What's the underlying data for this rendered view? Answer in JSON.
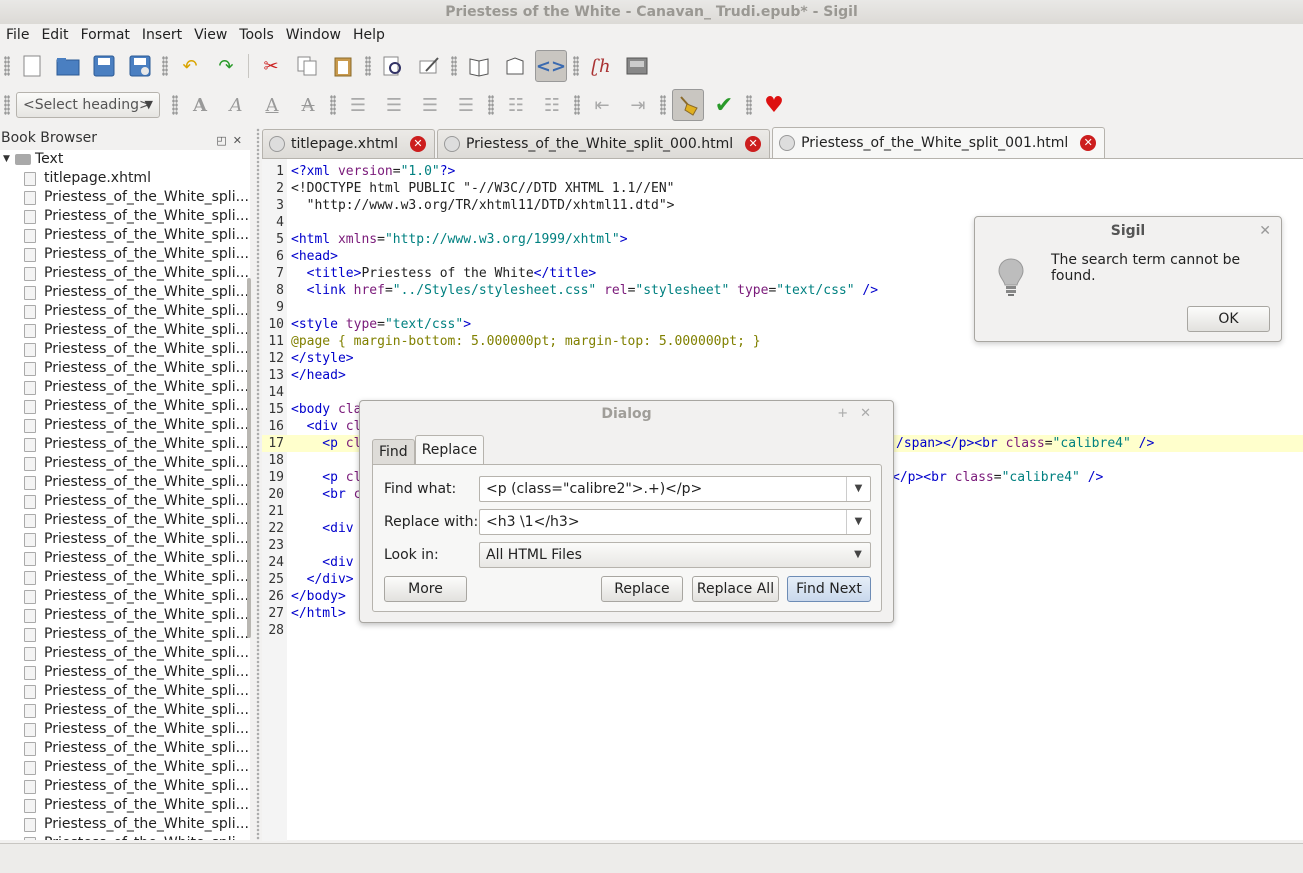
{
  "window": {
    "title": "Priestess of the White - Canavan_ Trudi.epub* - Sigil"
  },
  "menubar": {
    "items": [
      "File",
      "Edit",
      "Format",
      "Insert",
      "View",
      "Tools",
      "Window",
      "Help"
    ]
  },
  "toolbar2": {
    "heading_select": "<Select heading>"
  },
  "book_browser": {
    "title": "Book Browser",
    "folder": "Text",
    "first_file": "titlepage.xhtml",
    "file_label": "Priestess_of_the_White_spli..."
  },
  "tabs": [
    {
      "label": "titlepage.xhtml"
    },
    {
      "label": "Priestess_of_the_White_split_000.html"
    },
    {
      "label": "Priestess_of_the_White_split_001.html"
    }
  ],
  "editor": {
    "lines": [
      "1",
      "2",
      "3",
      "4",
      "5",
      "6",
      "7",
      "8",
      "9",
      "10",
      "11",
      "12",
      "13",
      "14",
      "15",
      "16",
      "17",
      "18",
      "19",
      "20",
      "21",
      "22",
      "23",
      "24",
      "25",
      "26",
      "27",
      "28"
    ],
    "code": {
      "l1a": "<?xml ",
      "l1b": "version",
      "l1c": "=",
      "l1d": "\"1.0\"",
      "l1e": "?>",
      "l2": "<!DOCTYPE html PUBLIC \"-//W3C//DTD XHTML 1.1//EN\"",
      "l3": "  \"http://www.w3.org/TR/xhtml11/DTD/xhtml11.dtd\">",
      "l5a": "<html ",
      "l5b": "xmlns",
      "l5c": "=",
      "l5d": "\"http://www.w3.org/1999/xhtml\"",
      "l5e": ">",
      "l6": "<head>",
      "l7a": "  <title>",
      "l7b": "Priestess of the White",
      "l7c": "</title>",
      "l8a": "  <link ",
      "l8b": "href",
      "l8c": "=",
      "l8d": "\"../Styles/stylesheet.css\"",
      "l8e": " rel",
      "l8f": "=",
      "l8g": "\"stylesheet\"",
      "l8h": " type",
      "l8i": "=",
      "l8j": "\"text/css\"",
      "l8k": " />",
      "l10a": "<style ",
      "l10b": "type",
      "l10c": "=",
      "l10d": "\"text/css\"",
      "l10e": ">",
      "l11": "@page { margin-bottom: 5.000000pt; margin-top: 5.000000pt; }",
      "l12": "</style>",
      "l13": "</head>",
      "l15a": "<body ",
      "l15b": "cla",
      "l16a": "  <div ",
      "l16b": "cl",
      "l17a": "    <p ",
      "l17b": "cl",
      "l17c": "/span></p><br ",
      "l17d": "class",
      "l17e": "=",
      "l17f": "\"calibre4\"",
      "l17g": " />",
      "l19a": "    <p ",
      "l19b": "cl",
      "l19c": "</p><br ",
      "l19d": "class",
      "l19e": "=",
      "l19f": "\"calibre4\"",
      "l19g": " />",
      "l20a": "    <br ",
      "l20b": "c",
      "l22": "    <div",
      "l24": "    <div",
      "l25": "  </div>",
      "l26": "</body>",
      "l27": "</html>"
    }
  },
  "find_dialog": {
    "title": "Dialog",
    "tab_find": "Find",
    "tab_replace": "Replace",
    "find_label": "Find what:",
    "find_value": "<p (class=\"calibre2\">.+)</p>",
    "replace_label": "Replace with:",
    "replace_value": "<h3 \\1</h3>",
    "lookin_label": "Look in:",
    "lookin_value": "All HTML Files",
    "more": "More",
    "replace": "Replace",
    "replace_all": "Replace All",
    "find_next": "Find Next"
  },
  "message_box": {
    "title": "Sigil",
    "text": "The search term cannot be found.",
    "ok": "OK"
  }
}
